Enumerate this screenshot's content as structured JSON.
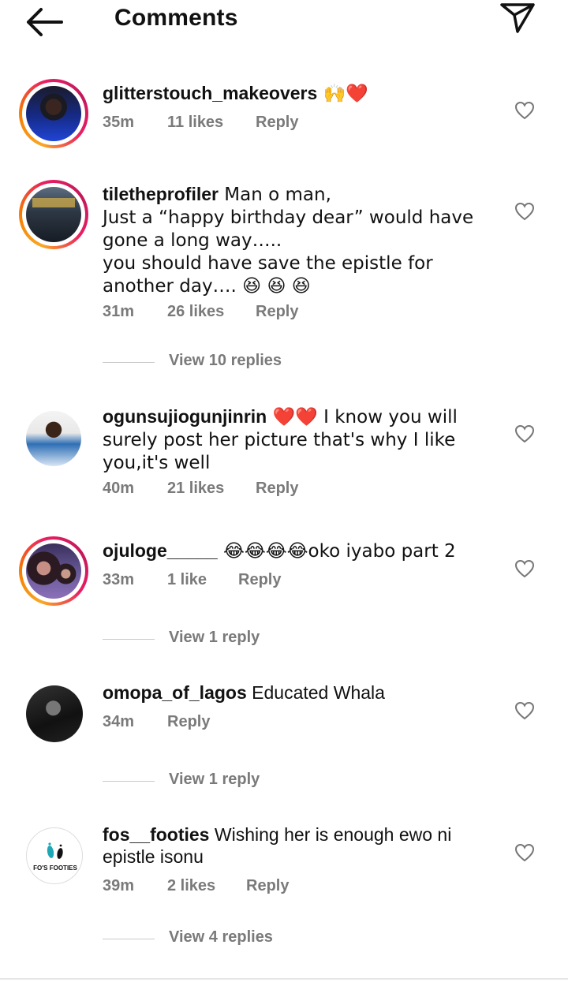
{
  "header": {
    "title": "Comments",
    "back_icon": "arrow-left-icon",
    "send_icon": "paper-plane-icon"
  },
  "comments": [
    {
      "username": "glitterstouch_makeovers",
      "text": " 🙌❤️",
      "time": "35m",
      "likes": "11 likes",
      "reply": "Reply",
      "avatar_ring": true
    },
    {
      "username": "tiletheprofiler",
      "text": " Man o man,\nJust a “happy birthday dear”  would have gone a long way…..\nyou should have save the epistle for another day…. 😆 😆 😆",
      "time": "31m",
      "likes": "26 likes",
      "reply": "Reply",
      "avatar_ring": true,
      "replies": "View 10 replies"
    },
    {
      "username": "ogunsujiogunjinrin",
      "text": " ❤️❤️ I know you will surely post her picture that's why I like you,it's well",
      "time": "40m",
      "likes": "21 likes",
      "reply": "Reply",
      "avatar_ring": false
    },
    {
      "username": "ojuloge_____",
      "text": " 😂😂😂😂oko iyabo part 2",
      "time": "33m",
      "likes": "1 like",
      "reply": "Reply",
      "avatar_ring": true,
      "replies": "View 1 reply"
    },
    {
      "username": "omopa_of_lagos",
      "text": " Educated Whala",
      "time": "34m",
      "reply": "Reply",
      "avatar_ring": false,
      "replies": "View 1 reply"
    },
    {
      "username": "fos__footies",
      "text": " Wishing her is enough ewo ni epistle isonu",
      "time": "39m",
      "likes": "2 likes",
      "reply": "Reply",
      "avatar_ring": false,
      "avatar_logo_text": "FO'S FOOTIES",
      "replies": "View 4 replies"
    }
  ]
}
